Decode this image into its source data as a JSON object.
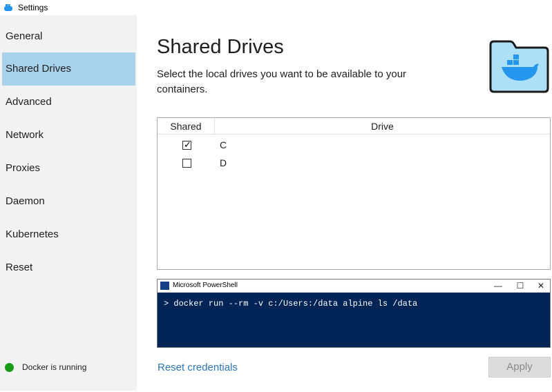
{
  "window": {
    "title": "Settings",
    "icon": "docker-whale-icon"
  },
  "sidebar": {
    "items": [
      {
        "label": "General"
      },
      {
        "label": "Shared Drives",
        "active": true
      },
      {
        "label": "Advanced"
      },
      {
        "label": "Network"
      },
      {
        "label": "Proxies"
      },
      {
        "label": "Daemon"
      },
      {
        "label": "Kubernetes"
      },
      {
        "label": "Reset"
      }
    ],
    "status": {
      "text": "Docker is running",
      "color": "#1a9c1a"
    }
  },
  "main": {
    "title": "Shared Drives",
    "description": "Select the local drives you want to be available to your containers.",
    "table": {
      "headers": {
        "shared": "Shared",
        "drive": "Drive"
      },
      "rows": [
        {
          "drive": "C",
          "shared": true
        },
        {
          "drive": "D",
          "shared": false
        }
      ]
    },
    "powershell": {
      "title": "Microsoft PowerShell",
      "command": "> docker run --rm -v c:/Users:/data alpine ls /data",
      "controls": {
        "minimize": "—",
        "maximize": "☐",
        "close": "✕"
      }
    },
    "reset_credentials": "Reset credentials",
    "apply": "Apply"
  },
  "colors": {
    "active_nav": "#a9d2ec",
    "link": "#2e76b6",
    "powershell_bg": "#012456",
    "docker_blue": "#2496ed"
  }
}
